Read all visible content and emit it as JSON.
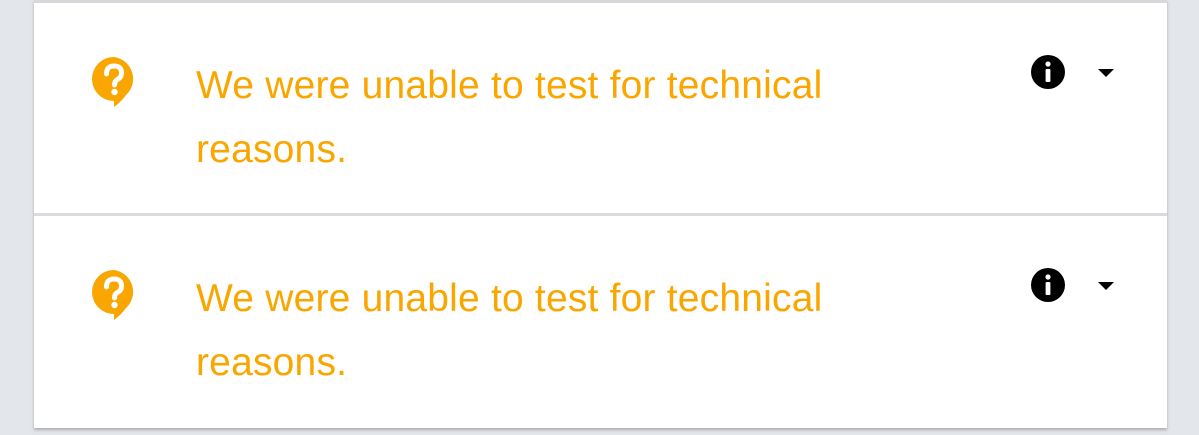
{
  "results": [
    {
      "status_icon": "help-bubble-icon",
      "message": "We were unable to test for technical reasons.",
      "info_icon": "info-icon",
      "toggle_icon": "caret-down-icon"
    },
    {
      "status_icon": "help-bubble-icon",
      "message": "We were unable to test for technical reasons.",
      "info_icon": "info-icon",
      "toggle_icon": "caret-down-icon"
    }
  ],
  "colors": {
    "warning": "#f9a600",
    "info_icon": "#000000",
    "card_background": "#ffffff",
    "page_background": "#e3e6ea",
    "divider": "#d9dbdf"
  }
}
